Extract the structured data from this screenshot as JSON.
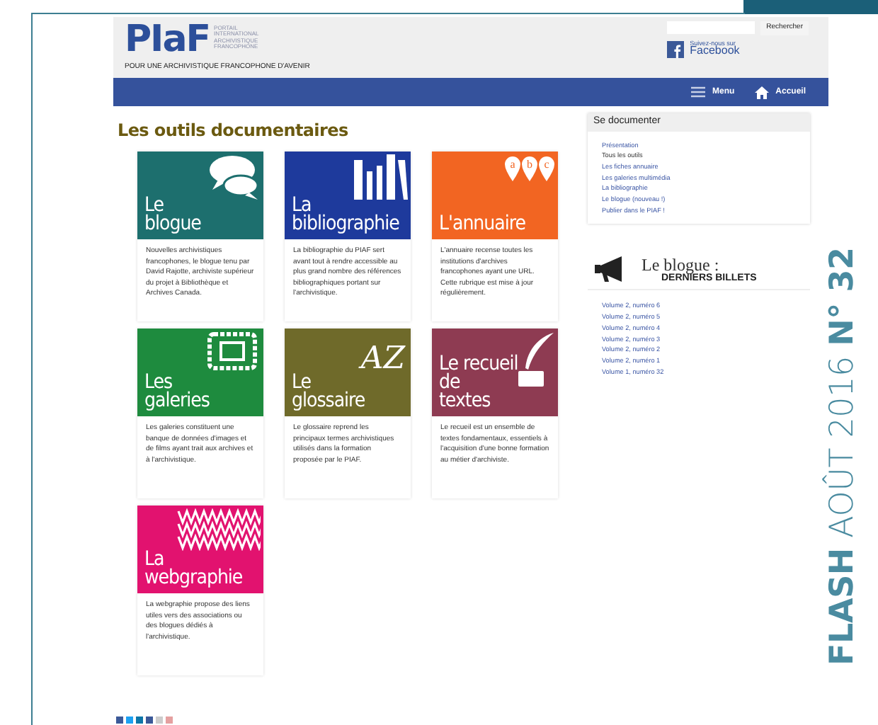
{
  "flash": "**FLASH** AOÛT 2016 **N° 32**",
  "header": {
    "logo": "PIaF",
    "logo_caption": [
      "PORTAIL",
      "INTERNATIONAL",
      "ARCHIVISTIQUE",
      "FRANCOPHONE"
    ],
    "tagline": "POUR UNE ARCHIVISTIQUE FRANCOPHONE D'AVENIR",
    "search_button": "Rechercher",
    "facebook_small": "Suivez-nous sur",
    "facebook": "Facebook"
  },
  "nav": [
    {
      "kind": "menu",
      "label": "Menu"
    },
    {
      "kind": "home",
      "label": "Accueil"
    }
  ],
  "title": "Les outils documentaires",
  "tools": [
    {
      "kind": "bubbles",
      "color": "#1d6f6e",
      "title_lines": [
        "Le",
        "blogue"
      ],
      "description": "Nouvelles archivistiques francophones, le blogue tenu par David Rajotte, archiviste supérieur du projet à Bibliothèque et Archives Canada."
    },
    {
      "kind": "books",
      "color": "#1e3a9c",
      "title_lines": [
        "La",
        "bibliographie"
      ],
      "description": "La bibliographie du PIAF sert avant tout à rendre accessible au plus grand nombre des références bibliographiques portant sur l'archivistique."
    },
    {
      "kind": "pins",
      "color": "#f26522",
      "icon_text": [
        "a",
        "b",
        "c"
      ],
      "title_lines": [
        "L'annuaire"
      ],
      "description": "L'annuaire recense toutes les institutions d'archives francophones ayant une URL. Cette rubrique est mise à jour régulièrement."
    },
    {
      "kind": "frame",
      "color": "#1e8b3e",
      "title_lines": [
        "Les",
        "galeries"
      ],
      "description": "Les galeries constituent une banque de données d'images et de films ayant trait aux archives et à l'archivistique."
    },
    {
      "kind": "letters",
      "color": "#6f6a2a",
      "icon_text": [
        "AZ"
      ],
      "title_lines": [
        "Le",
        "glossaire"
      ],
      "description": "Le glossaire reprend les principaux termes archivistiques utilisés dans la formation proposée par le PIAF."
    },
    {
      "kind": "quill",
      "color": "#8e3b52",
      "title_lines": [
        "Le recueil",
        "de",
        "textes"
      ],
      "description": "Le recueil est un ensemble de textes fondamentaux, essentiels à l'acquisition d'une bonne formation au métier d'archiviste."
    },
    {
      "kind": "zigzag",
      "color": "#e2126f",
      "title_lines": [
        "La",
        "webgraphie"
      ],
      "description": "La webgraphie propose des liens utiles vers des associations ou des blogues dédiés à l'archivistique."
    }
  ],
  "sidebar": {
    "title": "Se documenter",
    "links": [
      {
        "label": "Présentation",
        "selected": false
      },
      {
        "label": "Tous les outils",
        "selected": true
      },
      {
        "label": "Les fiches annuaire",
        "selected": false
      },
      {
        "label": "Les galeries multimédia",
        "selected": false
      },
      {
        "label": "La bibliographie",
        "selected": false
      },
      {
        "label": "Le blogue (nouveau !)",
        "selected": false
      },
      {
        "label": "Publier dans le PIAF !",
        "selected": false
      }
    ]
  },
  "blog": {
    "title": "Le blogue :",
    "subtitle": "DERNIERS BILLETS",
    "posts": [
      "Volume 2, numéro 6",
      "Volume 2, numéro 5",
      "Volume 2, numéro 4",
      "Volume 2, numéro 3",
      "Volume 2, numéro 2",
      "Volume 2, numéro 1",
      "Volume 1, numéro 32"
    ]
  }
}
